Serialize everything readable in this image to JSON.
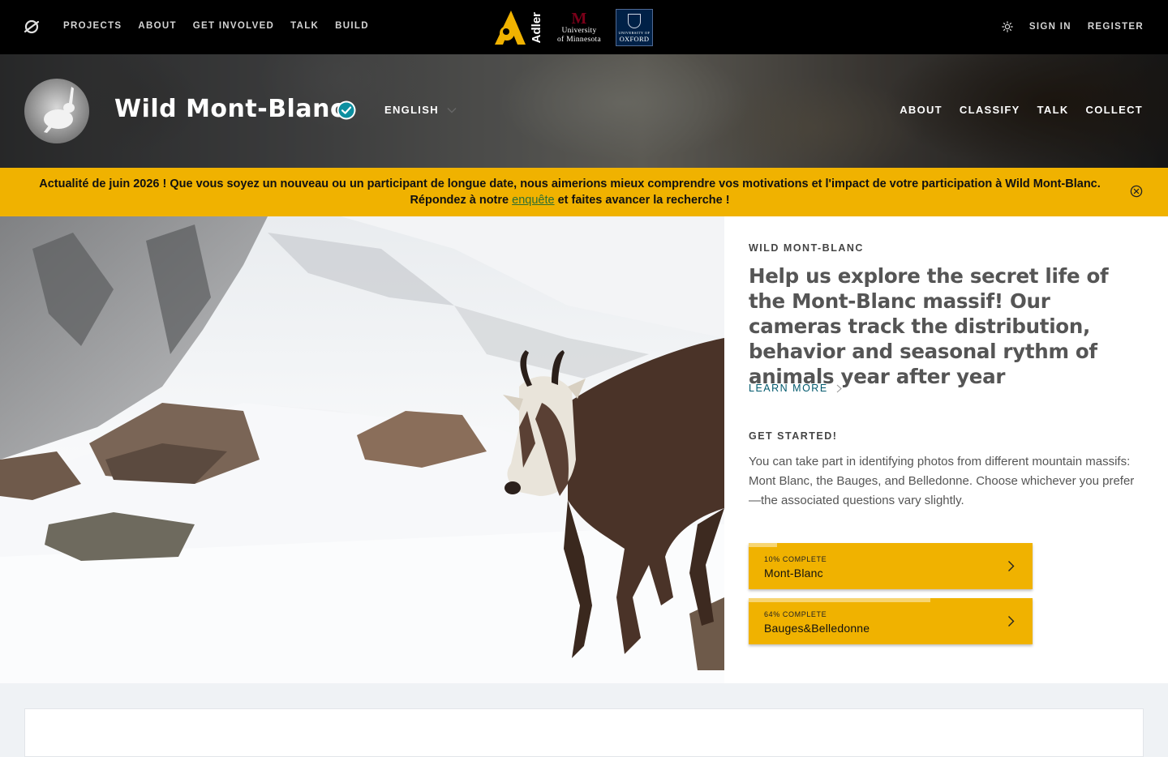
{
  "topnav": {
    "logo_icon": "zooniverse-logo-icon",
    "links": [
      "PROJECTS",
      "ABOUT",
      "GET INVOLVED",
      "TALK",
      "BUILD"
    ],
    "partners": {
      "adler": "Adler",
      "umn_line1": "University",
      "umn_line2": "of Minnesota",
      "oxford_line1": "UNIVERSITY OF",
      "oxford_line2": "OXFORD"
    },
    "theme_icon": "sun-icon",
    "sign_in": "SIGN IN",
    "register": "REGISTER"
  },
  "project": {
    "title": "Wild Mont-Blanc",
    "verified_icon": "check-badge-icon",
    "language": "ENGLISH",
    "nav": [
      "ABOUT",
      "CLASSIFY",
      "TALK",
      "COLLECT"
    ]
  },
  "announcement": {
    "text_before": "Actualité de juin 2026 ! Que vous soyez un nouveau ou un participant de longue date, nous aimerions mieux comprendre vos motivations et l'impact de votre participation à Wild Mont-Blanc. Répondez à notre ",
    "link": "enquête",
    "text_after": " et faites avancer la recherche !",
    "close_icon": "close-circle-icon"
  },
  "hero": {
    "eyebrow": "WILD MONT-BLANC",
    "intro": "Help us explore the secret life of the Mont-Blanc massif! Our cameras track the distribution, behavior and seasonal rythm of animals year after year",
    "learn_more": "LEARN MORE",
    "get_started": "GET STARTED!",
    "description": "You can take part in identifying photos from different mountain massifs: Mont Blanc, the Bauges, and Belledonne. Choose whichever you prefer—the associated questions vary slightly.",
    "workflows": [
      {
        "percent_label": "10% COMPLETE",
        "name": "Mont-Blanc",
        "progress": 0.1
      },
      {
        "percent_label": "64% COMPLETE",
        "name": "Bauges&Belledonne",
        "progress": 0.64
      }
    ]
  },
  "colors": {
    "accent": "#f0b200",
    "link": "#00596d",
    "nav_bg": "#000000",
    "verified": "#0c8fa0"
  }
}
